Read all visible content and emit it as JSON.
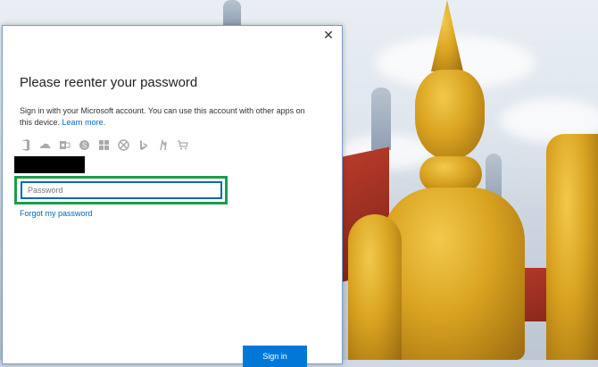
{
  "dialog": {
    "title": "Please reenter your password",
    "description": "Sign in with your Microsoft account. You can use this account with other apps on this device.",
    "learn_more": "Learn more.",
    "close_glyph": "✕",
    "app_icons": [
      "office-icon",
      "onedrive-icon",
      "outlook-icon",
      "skype-icon",
      "windows-icon",
      "xbox-icon",
      "bing-icon",
      "msn-icon",
      "store-icon"
    ],
    "password": {
      "placeholder": "Password",
      "value": ""
    },
    "forgot": "Forgot my password",
    "signin": "Sign in"
  },
  "colors": {
    "accent": "#0078d7",
    "link": "#0067b8",
    "focus_highlight": "#1e9c4a",
    "redaction": "#000000"
  }
}
